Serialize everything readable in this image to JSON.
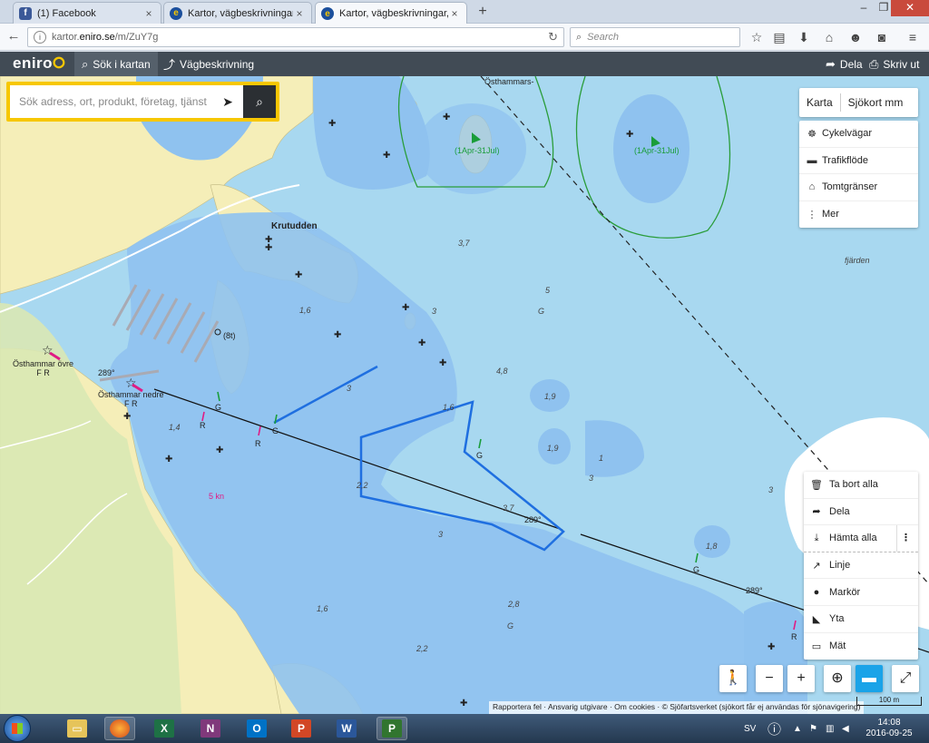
{
  "browser": {
    "tabs": [
      {
        "title": "(1) Facebook",
        "icon": "facebook-icon"
      },
      {
        "title": "Kartor, vägbeskrivningar, fl...",
        "icon": "eniro-icon"
      },
      {
        "title": "Kartor, vägbeskrivningar, fl...",
        "icon": "eniro-icon"
      }
    ],
    "new_tab": "+",
    "url_host": "kartor.",
    "url_domain": "eniro.se",
    "url_path": "/m/ZuY7g",
    "search_placeholder": "Search"
  },
  "header": {
    "logo": "eniro",
    "nav": [
      {
        "label": "Sök i kartan"
      },
      {
        "label": "Vägbeskrivning"
      }
    ],
    "share": "Dela",
    "print": "Skriv ut"
  },
  "search": {
    "placeholder": "Sök adress, ort, produkt, företag, tjänst"
  },
  "maptype": {
    "option1": "Karta",
    "option2": "Sjökort mm"
  },
  "layers": [
    {
      "label": "Cykelvägar",
      "icon": "bicycle-icon"
    },
    {
      "label": "Trafikflöde",
      "icon": "car-icon"
    },
    {
      "label": "Tomtgränser",
      "icon": "property-icon"
    },
    {
      "label": "Mer",
      "icon": "more-vertical-icon"
    }
  ],
  "tools": [
    {
      "label": "Ta bort alla",
      "icon": "trash-icon"
    },
    {
      "label": "Dela",
      "icon": "share-icon"
    },
    {
      "label": "Hämta alla",
      "icon": "download-icon"
    },
    {
      "label": "Linje",
      "icon": "line-icon"
    },
    {
      "label": "Markör",
      "icon": "marker-icon"
    },
    {
      "label": "Yta",
      "icon": "area-icon"
    },
    {
      "label": "Mät",
      "icon": "ruler-icon"
    }
  ],
  "map_labels": {
    "osthammars_top": "Östhammars-",
    "krutudden": "Krutudden",
    "fjarden": "fjärden",
    "osthammar_ovre": "Östhammar övre",
    "osthammar_ovre_fr": "F R",
    "osthammar_nedre": "Östhammar nedre",
    "osthammar_nedre_fr": "F R",
    "speed": "5 kn",
    "season1": "(1Apr-31Jul)",
    "season2": "(1Apr-31Jul)",
    "light": "(8t)",
    "course1": "289°",
    "course2": "289°",
    "course3": "289°",
    "depths": [
      "3,7",
      "5",
      "G",
      "1,6",
      "3",
      "4,8",
      "1,9",
      "1,6",
      "1,9",
      "1",
      "3",
      "3",
      "2,2",
      "3,7",
      "3",
      "1,8",
      "1,4",
      "2,8",
      "G",
      "1,6",
      "2,2",
      "G",
      "3"
    ],
    "markers_g": [
      "G",
      "G",
      "G",
      "G"
    ],
    "markers_r": [
      "R",
      "R",
      "R"
    ]
  },
  "scale": "100 m",
  "attribution": "Rapportera fel · Ansvarig utgivare · Om cookies · © Sjöfartsverket (sjökort får ej användas för sjönavigering)",
  "taskbar": {
    "lang": "SV",
    "time": "14:08",
    "date": "2016-09-25"
  }
}
